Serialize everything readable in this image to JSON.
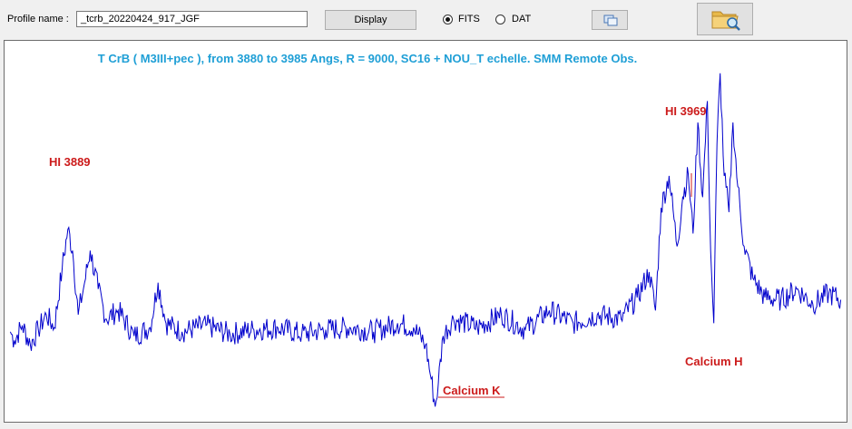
{
  "toolbar": {
    "profile_label": "Profile name :",
    "profile_value": "_tcrb_20220424_917_JGF",
    "display_label": "Display",
    "fits_label": "FITS",
    "dat_label": "DAT",
    "selected_format": "FITS",
    "copy_icon": "copy-windows-icon",
    "folder_icon": "folder-search-icon"
  },
  "chart_data": {
    "type": "line",
    "title": "T CrB ( M3III+pec ), from 3880 to 3985 Angs, R = 9000, SC16 + NOU_T echelle. SMM Remote Obs.",
    "xlabel": "",
    "ylabel": "",
    "xlim": [
      3880,
      3985
    ],
    "line_color": "#0000cc",
    "annotation_color": "#cc1b1b",
    "grid": false,
    "annotations": [
      {
        "text": "HI 3889",
        "x": 3887.7
      },
      {
        "text": "HI 3969",
        "x": 3968.6
      },
      {
        "text": "Calcium K",
        "x": 3933.7
      },
      {
        "text": "Calcium H",
        "x": 3968.5
      }
    ],
    "series": [
      {
        "x": [
          3880.5,
          3881.0,
          3882.0,
          3883.0,
          3884.0,
          3885.0,
          3886.0,
          3887.0,
          3887.7,
          3888.3,
          3889.0,
          3889.8,
          3890.5,
          3891.5,
          3892.5,
          3894.0,
          3896.0,
          3898.0,
          3899.0,
          3900.0,
          3902.0,
          3905.0,
          3908.0,
          3911.0,
          3914.0,
          3917.0,
          3920.0,
          3923.0,
          3926.0,
          3929.0,
          3931.0,
          3932.5,
          3933.2,
          3933.7,
          3934.1,
          3934.7,
          3936.0,
          3939.0,
          3942.0,
          3945.0,
          3948.0,
          3951.0,
          3954.0,
          3957.0,
          3959.0,
          3960.5,
          3961.3,
          3962.0,
          3963.0,
          3964.0,
          3964.7,
          3965.4,
          3966.0,
          3966.6,
          3967.2,
          3967.8,
          3968.2,
          3968.6,
          3969.0,
          3969.4,
          3969.9,
          3970.5,
          3971.0,
          3971.6,
          3972.4,
          3973.5,
          3975.0,
          3977.0,
          3979.0,
          3981.0,
          3983.0,
          3984.5
        ],
        "y": [
          0.32,
          0.28,
          0.35,
          0.26,
          0.33,
          0.4,
          0.34,
          0.62,
          0.8,
          0.7,
          0.4,
          0.55,
          0.7,
          0.52,
          0.38,
          0.42,
          0.3,
          0.34,
          0.55,
          0.36,
          0.32,
          0.35,
          0.31,
          0.33,
          0.34,
          0.31,
          0.33,
          0.34,
          0.32,
          0.36,
          0.34,
          0.26,
          0.1,
          -0.03,
          0.08,
          0.3,
          0.38,
          0.34,
          0.4,
          0.33,
          0.42,
          0.36,
          0.4,
          0.38,
          0.48,
          0.6,
          0.42,
          0.9,
          1.05,
          0.72,
          0.95,
          1.06,
          0.78,
          1.3,
          0.95,
          1.4,
          0.7,
          0.36,
          1.2,
          1.53,
          1.05,
          0.88,
          1.3,
          1.0,
          0.72,
          0.57,
          0.48,
          0.47,
          0.52,
          0.45,
          0.5,
          0.47
        ]
      }
    ]
  }
}
